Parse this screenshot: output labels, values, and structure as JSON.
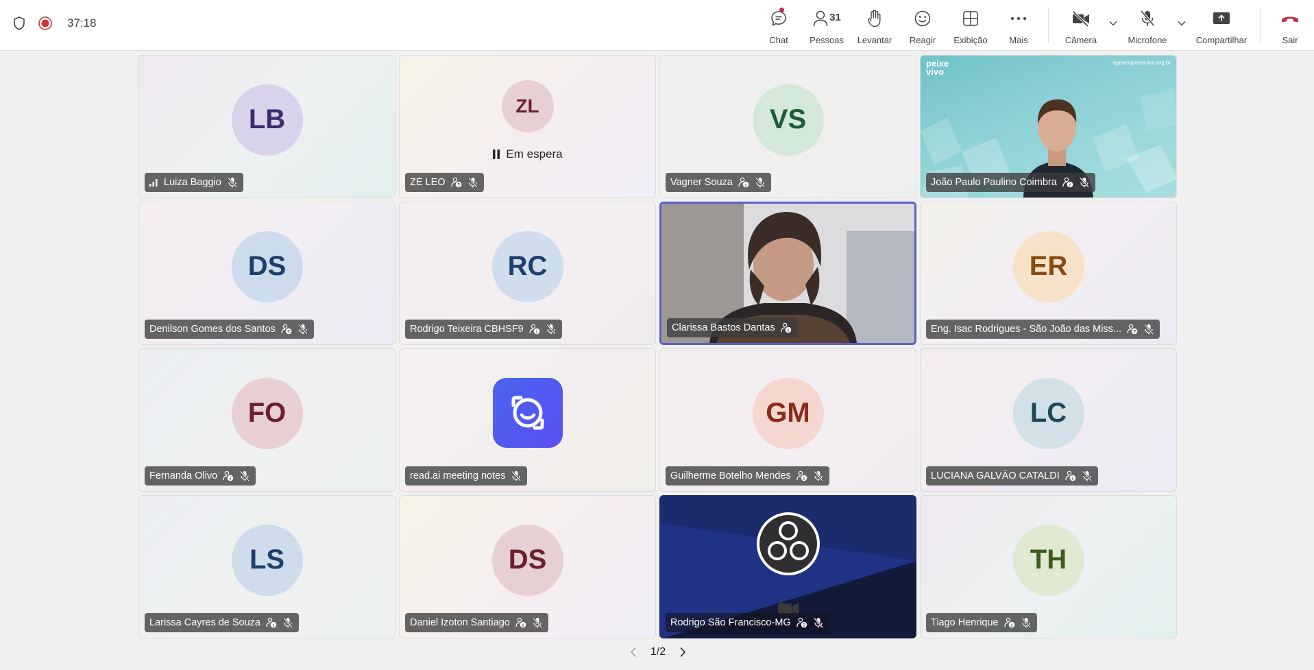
{
  "topbar": {
    "timer": "37:18",
    "icons": {
      "shield": "shield-icon",
      "record": "recording-icon"
    }
  },
  "toolbar": {
    "chat": "Chat",
    "people": "Pessoas",
    "people_count": "31",
    "raise": "Levantar",
    "react": "Reagir",
    "view": "Exibição",
    "more": "Mais",
    "camera": "Câmera",
    "mic": "Microfone",
    "share": "Compartilhar",
    "leave": "Sair"
  },
  "colors": {
    "leave": "#c4314b",
    "accent": "#5b5fc7",
    "record": "#d13438"
  },
  "tiles": [
    {
      "initials": "LB",
      "name": "Luiza Baggio"
    },
    {
      "initials": "ZL",
      "name": "ZÉ LEO",
      "status": "Em espera"
    },
    {
      "initials": "VS",
      "name": "Vagner Souza"
    },
    {
      "name": "João Paulo Paulino Coimbra",
      "logo": "peixe vivo",
      "site": "agenciapeixevivo.org.br"
    },
    {
      "initials": "DS",
      "name": "Denilson Gomes dos Santos"
    },
    {
      "initials": "RC",
      "name": "Rodrigo Teixeira CBHSF9"
    },
    {
      "name": "Clarissa Bastos Dantas"
    },
    {
      "initials": "ER",
      "name": "Eng. Isac Rodrigues - São João das Miss..."
    },
    {
      "initials": "FO",
      "name": "Fernanda Olivo"
    },
    {
      "name": "read.ai meeting notes"
    },
    {
      "initials": "GM",
      "name": "Guilherme Botelho Mendes"
    },
    {
      "initials": "LC",
      "name": "LUCIANA GALVÃO CATALDI"
    },
    {
      "initials": "LS",
      "name": "Larissa Cayres de Souza"
    },
    {
      "initials": "DS",
      "name": "Daniel Izoton Santiago"
    },
    {
      "name": "Rodrigo São Francisco-MG"
    },
    {
      "initials": "TH",
      "name": "Tiago Henrique"
    }
  ],
  "pager": {
    "label": "1/2"
  }
}
